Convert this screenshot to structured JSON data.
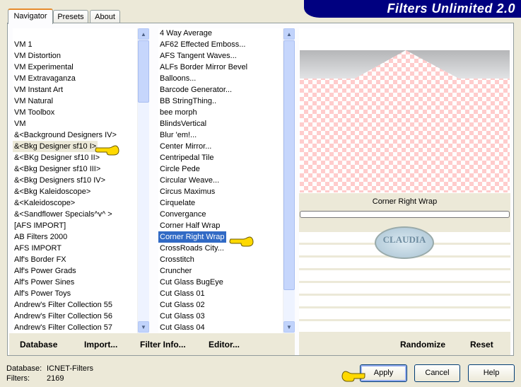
{
  "title": "Filters Unlimited 2.0",
  "tabs": [
    {
      "label": "Navigator",
      "active": true
    },
    {
      "label": "Presets"
    },
    {
      "label": "About"
    }
  ],
  "categories": {
    "selected": "&<Bkg Designer sf10 I>",
    "items": [
      "VM 1",
      "VM Distortion",
      "VM Experimental",
      "VM Extravaganza",
      "VM Instant Art",
      "VM Natural",
      "VM Toolbox",
      "VM",
      "&<Background Designers IV>",
      "&<Bkg Designer sf10 I>",
      "&<BKg Designer sf10 II>",
      "&<Bkg Designer sf10 III>",
      "&<Bkg Designers sf10 IV>",
      "&<Bkg Kaleidoscope>",
      "&<Kaleidoscope>",
      "&<Sandflower Specials^v^ >",
      "[AFS IMPORT]",
      "AB Filters 2000",
      "AFS IMPORT",
      "Alf's Border FX",
      "Alf's Power Grads",
      "Alf's Power Sines",
      "Alf's Power Toys",
      "Andrew's Filter Collection 55",
      "Andrew's Filter Collection 56",
      "Andrew's Filter Collection 57"
    ]
  },
  "filters": {
    "selected": "Corner Right Wrap",
    "items": [
      "4 Way Average",
      "AF62 Effected Emboss...",
      "AFS Tangent Waves...",
      "ALFs Border Mirror Bevel",
      "Balloons...",
      "Barcode Generator...",
      "BB StringThing..",
      "bee morph",
      "BlindsVertical",
      "Blur 'em!...",
      "Center Mirror...",
      "Centripedal Tile",
      "Circle Pede",
      "Circular Weave...",
      "Circus Maximus",
      "Cirquelate",
      "Convergance",
      "Corner Half Wrap",
      "Corner Right Wrap",
      "CrossRoads City...",
      "Crosstitch",
      "Cruncher",
      "Cut Glass  BugEye",
      "Cut Glass 01",
      "Cut Glass 02",
      "Cut Glass 03",
      "Cut Glass 04"
    ]
  },
  "preview": {
    "filter_name": "Corner Right Wrap",
    "watermark": "CLAUDIA"
  },
  "toolbar": {
    "database": "Database",
    "import": "Import...",
    "filter_info": "Filter Info...",
    "editor": "Editor...",
    "randomize": "Randomize",
    "reset": "Reset"
  },
  "status": {
    "database_label": "Database:",
    "database_value": "ICNET-Filters",
    "filters_label": "Filters:",
    "filters_value": "2169"
  },
  "buttons": {
    "apply": "Apply",
    "cancel": "Cancel",
    "help": "Help"
  },
  "colors": {
    "banner": "#000080",
    "selection": "#316ac5",
    "background": "#ece9d8"
  }
}
